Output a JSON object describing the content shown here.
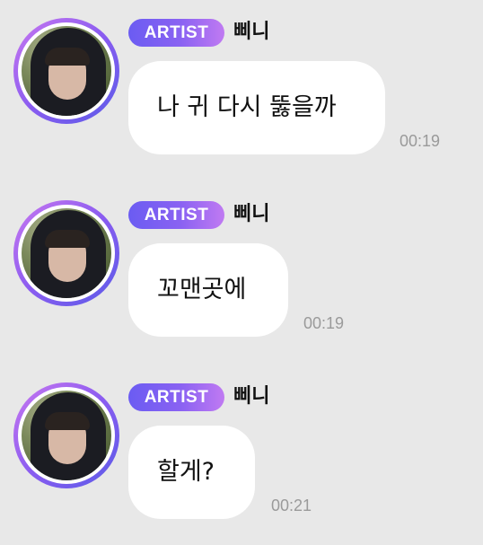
{
  "messages": [
    {
      "badge": "ARTIST",
      "sender": "삐니",
      "text": "나 귀 다시 뚫을까",
      "time": "00:19"
    },
    {
      "badge": "ARTIST",
      "sender": "삐니",
      "text": "꼬맨곳에",
      "time": "00:19"
    },
    {
      "badge": "ARTIST",
      "sender": "삐니",
      "text": "할게?",
      "time": "00:21"
    }
  ],
  "colors": {
    "background": "#e8e8e8",
    "bubble": "#ffffff",
    "badge_gradient_start": "#6b5cf2",
    "badge_gradient_end": "#c07af2",
    "timestamp": "#9a9a9a"
  },
  "icons": {
    "avatar": "profile-photo-hooded-person"
  }
}
